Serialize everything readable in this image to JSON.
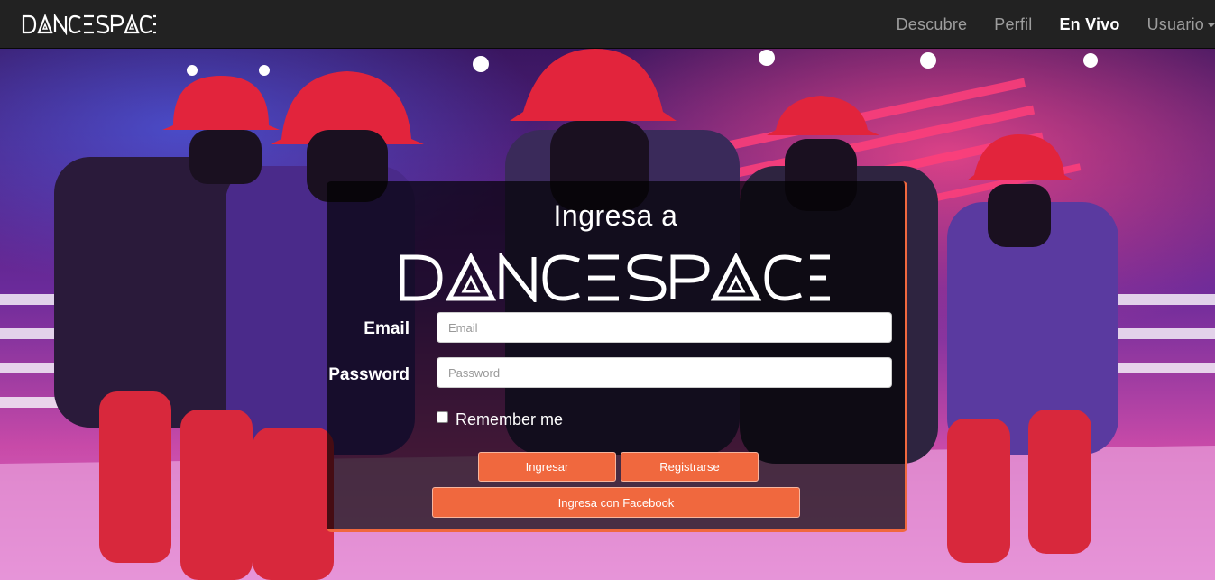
{
  "navbar": {
    "brand": "DANCESPACE",
    "links": [
      {
        "label": "Descubre",
        "active": false
      },
      {
        "label": "Perfil",
        "active": false
      },
      {
        "label": "En Vivo",
        "active": true
      },
      {
        "label": "Usuario",
        "active": false,
        "dropdown": true
      }
    ]
  },
  "login": {
    "title": "Ingresa a",
    "logo_text": "DANCESPACE",
    "email_label": "Email",
    "email_placeholder": "Email",
    "password_label": "Password",
    "password_placeholder": "Password",
    "remember_label": "Remember me",
    "login_button": "Ingresar",
    "register_button": "Registrarse",
    "facebook_button": "Ingresa con Facebook"
  },
  "colors": {
    "navbar_bg": "#222222",
    "accent": "#f0683e",
    "hero_purple": "#5a2a8a",
    "hero_red": "#e0304a"
  }
}
